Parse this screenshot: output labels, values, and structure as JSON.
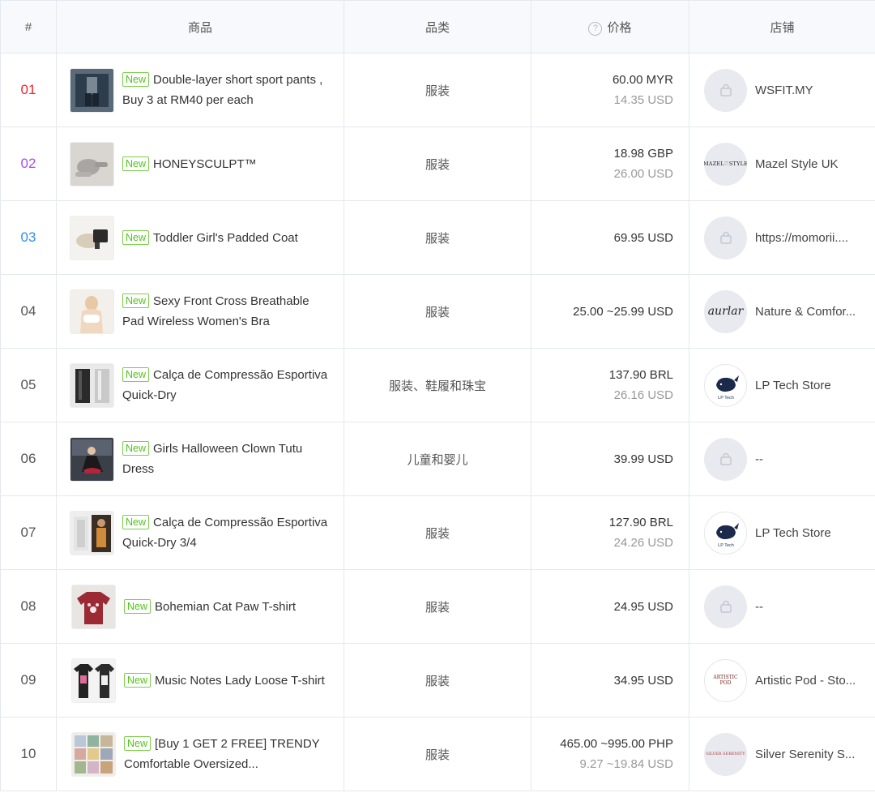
{
  "colors": {
    "rank1": "#f5222d",
    "rank2": "#a84cf0",
    "rank3": "#2f8fe8",
    "badge": "#52c41a"
  },
  "header": {
    "rank": "#",
    "product": "商品",
    "category": "品类",
    "price": "价格",
    "shop": "店铺"
  },
  "rows": [
    {
      "rank": "01",
      "badge": "New",
      "title": "Double-layer short sport pants , Buy 3 at RM40 per each",
      "category": "服装",
      "price": "60.00 MYR",
      "price_usd": "14.35 USD",
      "shop": "WSFIT.MY",
      "shop_icon": "shop-placeholder-icon"
    },
    {
      "rank": "02",
      "badge": "New",
      "title": "HONEYSCULPT™",
      "category": "服装",
      "price": "18.98 GBP",
      "price_usd": "26.00 USD",
      "shop": "Mazel Style UK",
      "shop_icon": "mazel-style-logo",
      "shop_logo_text": "MAZEL♡STYLE"
    },
    {
      "rank": "03",
      "badge": "New",
      "title": "Toddler Girl's Padded Coat",
      "category": "服装",
      "price": "69.95 USD",
      "price_usd": "",
      "shop": "https://momorii....",
      "shop_icon": "shop-placeholder-icon"
    },
    {
      "rank": "04",
      "badge": "New",
      "title": "Sexy Front Cross Breathable Pad Wireless Women's Bra",
      "category": "服装",
      "price": "25.00 ~25.99 USD",
      "price_usd": "",
      "shop": "Nature & Comfor...",
      "shop_icon": "aurlar-logo",
      "shop_logo_text": "aurlar"
    },
    {
      "rank": "05",
      "badge": "New",
      "title": "Calça de Compressão Esportiva Quick-Dry",
      "category": "服装、鞋履和珠宝",
      "price": "137.90 BRL",
      "price_usd": "26.16 USD",
      "shop": "LP Tech Store",
      "shop_icon": "whale-logo",
      "shop_logo_text": "LP Tech"
    },
    {
      "rank": "06",
      "badge": "New",
      "title": "Girls Halloween Clown Tutu Dress",
      "category": "儿童和婴儿",
      "price": "39.99 USD",
      "price_usd": "",
      "shop": "--",
      "shop_icon": "shop-placeholder-icon"
    },
    {
      "rank": "07",
      "badge": "New",
      "title": "Calça de Compressão Esportiva Quick-Dry 3/4",
      "category": "服装",
      "price": "127.90 BRL",
      "price_usd": "24.26 USD",
      "shop": "LP Tech Store",
      "shop_icon": "whale-logo",
      "shop_logo_text": "LP Tech"
    },
    {
      "rank": "08",
      "badge": "New",
      "title": "Bohemian Cat Paw T-shirt",
      "category": "服装",
      "price": "24.95 USD",
      "price_usd": "",
      "shop": "--",
      "shop_icon": "shop-placeholder-icon"
    },
    {
      "rank": "09",
      "badge": "New",
      "title": "Music Notes Lady Loose T-shirt",
      "category": "服装",
      "price": "34.95 USD",
      "price_usd": "",
      "shop": "Artistic Pod - Sto...",
      "shop_icon": "artistic-pod-logo",
      "shop_logo_text": "ARTISTIC POD"
    },
    {
      "rank": "10",
      "badge": "New",
      "title": "[Buy 1 GET 2 FREE] TRENDY Comfortable Oversized...",
      "category": "服装",
      "price": "465.00 ~995.00 PHP",
      "price_usd": "9.27 ~19.84 USD",
      "shop": "Silver Serenity S...",
      "shop_icon": "silver-serenity-logo",
      "shop_logo_text": "SILVER SERENITY"
    }
  ]
}
